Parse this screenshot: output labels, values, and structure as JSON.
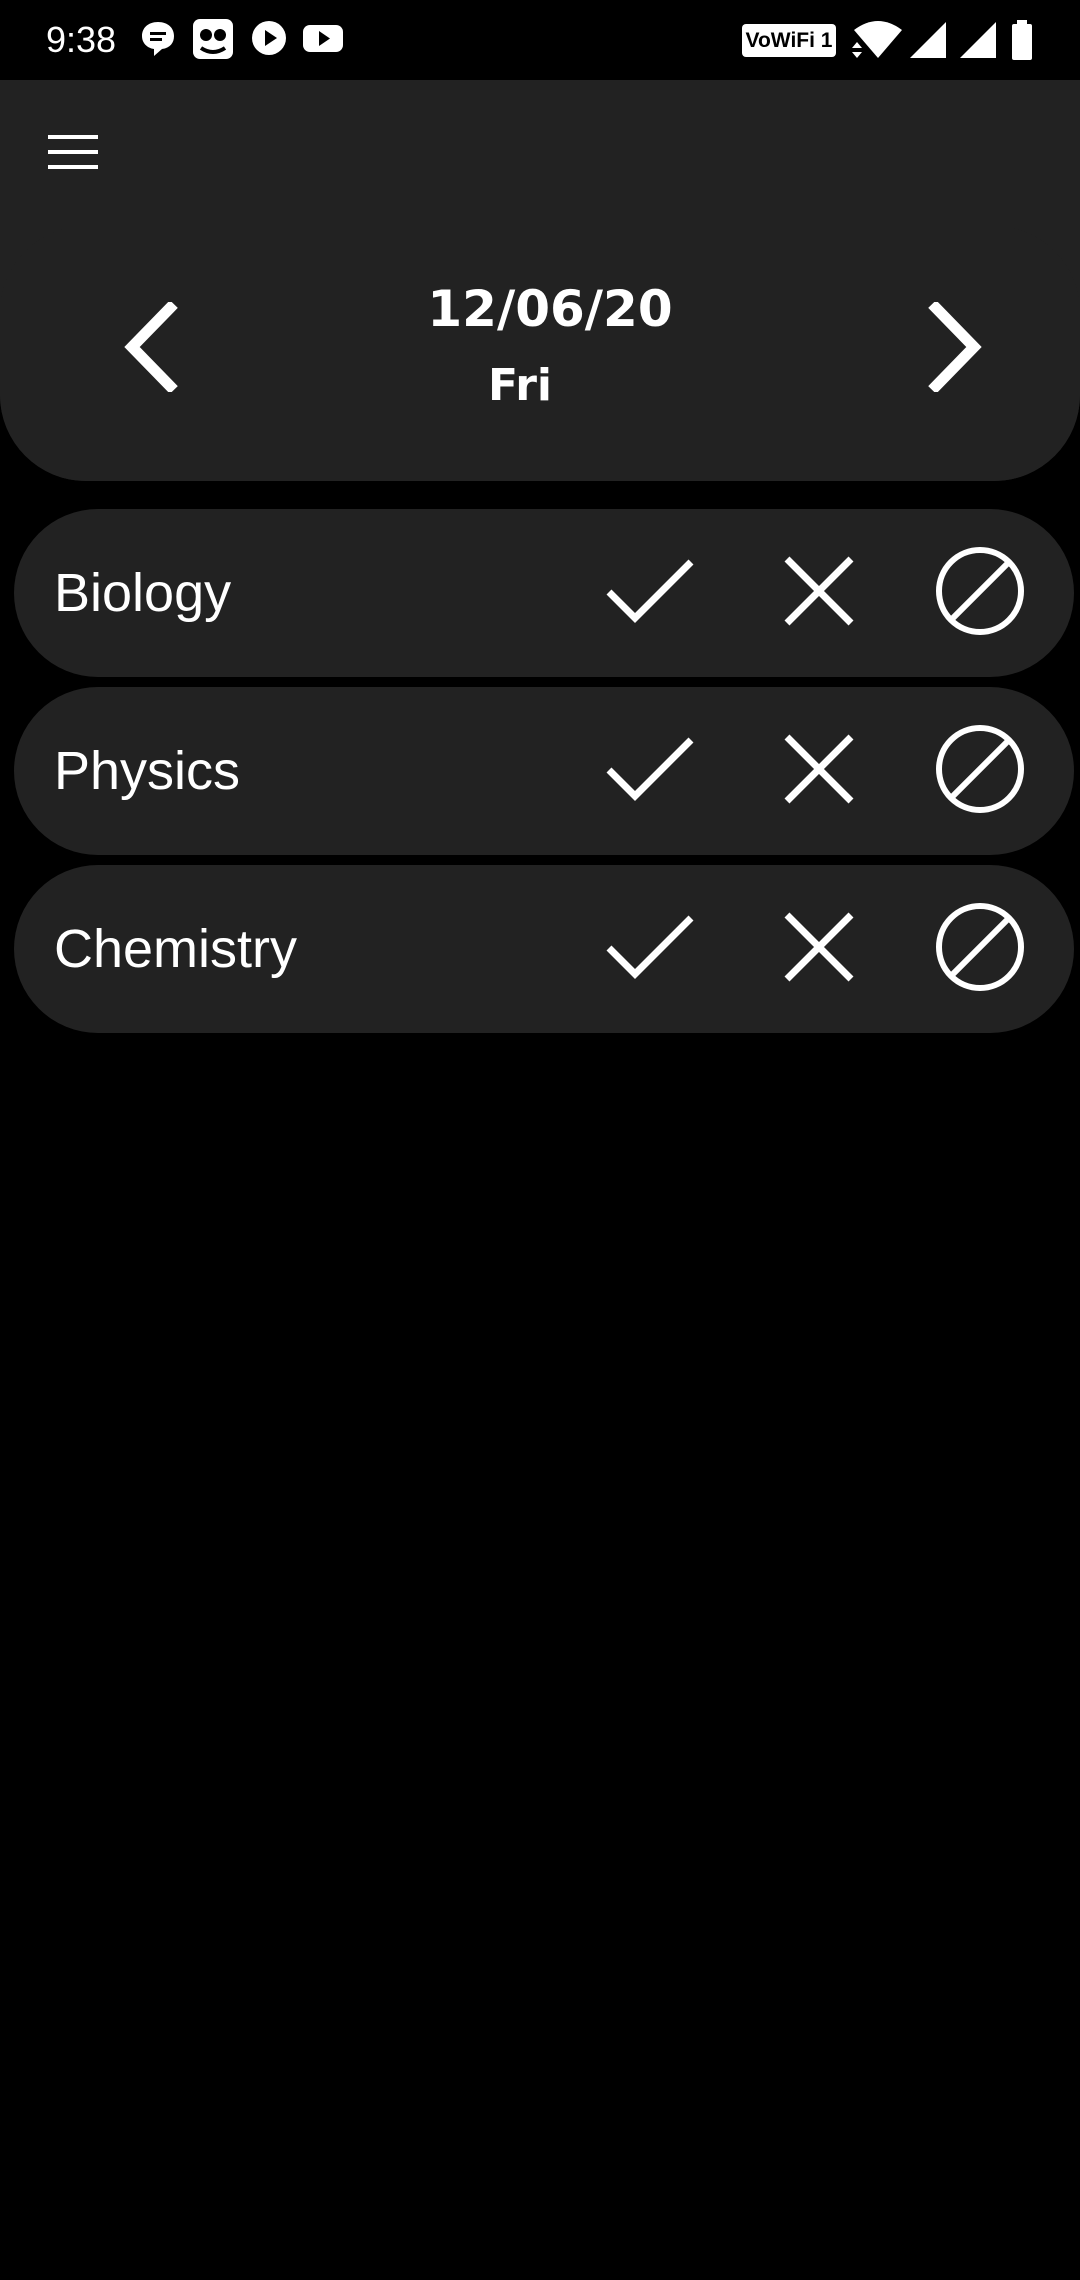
{
  "status_bar": {
    "time": "9:38",
    "wifi_calling_label": "VoWiFi 1",
    "notification_icons": [
      "chat-bubble-icon",
      "cat-app-icon",
      "play-circle-icon",
      "youtube-icon"
    ],
    "system_icons": [
      "wifi-icon",
      "signal-icon",
      "signal-icon",
      "battery-icon"
    ]
  },
  "app_bar": {
    "menu_icon": "hamburger-menu-icon"
  },
  "date_header": {
    "date": "12/06/20",
    "day": "Fri",
    "prev_icon": "chevron-left-icon",
    "next_icon": "chevron-right-icon"
  },
  "subjects": [
    {
      "name": "Biology"
    },
    {
      "name": "Physics"
    },
    {
      "name": "Chemistry"
    }
  ],
  "row_actions": [
    "check-icon",
    "close-icon",
    "block-icon"
  ],
  "colors": {
    "background": "#000000",
    "surface": "#222222",
    "foreground": "#ffffff"
  }
}
